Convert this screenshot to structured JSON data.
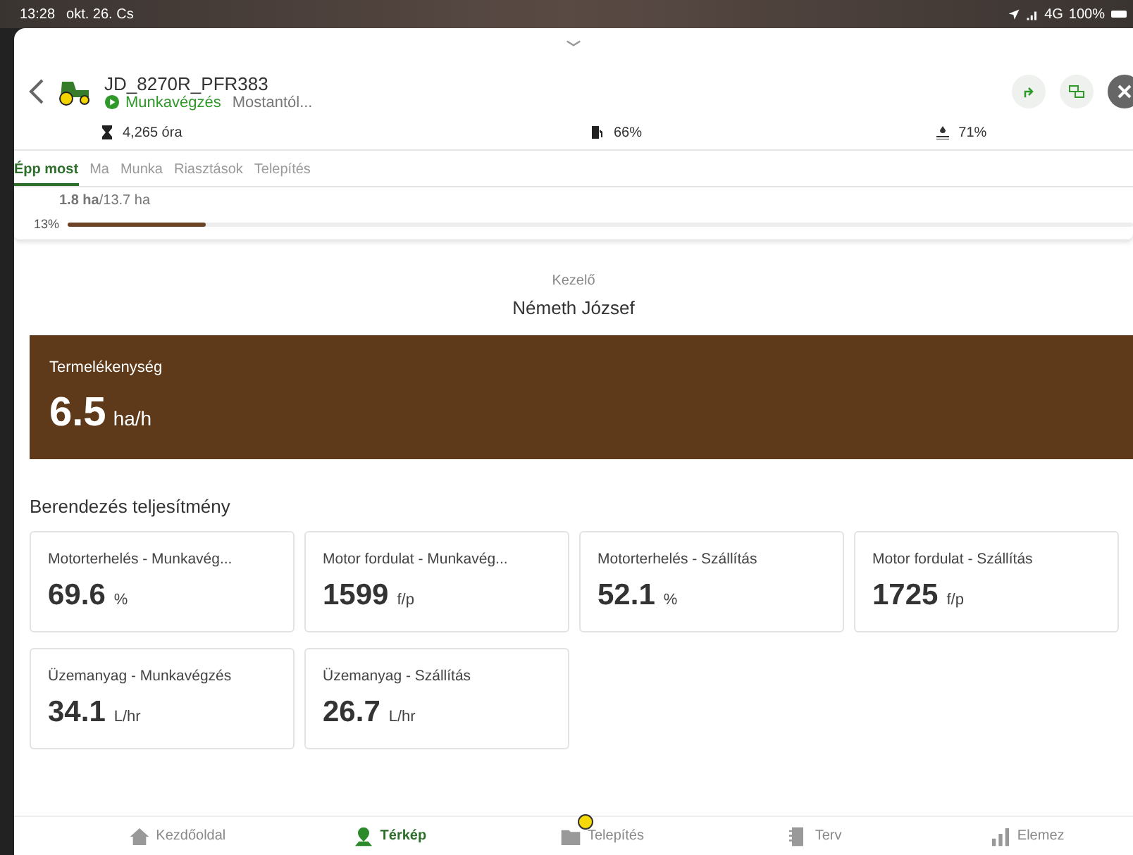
{
  "status_bar": {
    "time": "13:28",
    "date": "okt. 26. Cs",
    "network": "4G",
    "battery": "100%"
  },
  "header": {
    "title": "JD_8270R_PFR383",
    "state": "Munkavégzés",
    "since": "Mostantól..."
  },
  "stats": [
    {
      "kind": "hours",
      "text": "4,265 óra"
    },
    {
      "kind": "fuel",
      "text": "66%"
    },
    {
      "kind": "def",
      "text": "71%"
    }
  ],
  "tabs": [
    {
      "label": "Épp most",
      "selected": true
    },
    {
      "label": "Ma",
      "selected": false
    },
    {
      "label": "Munka",
      "selected": false
    },
    {
      "label": "Riasztások",
      "selected": false
    },
    {
      "label": "Telepítés",
      "selected": false
    }
  ],
  "progress": {
    "area": "**1.8 ha**/13.7 ha",
    "percent": "13%",
    "level": 0.13
  },
  "operator": {
    "label": "Kezelő",
    "name": "Németh József"
  },
  "productivity": {
    "label": "Termelékenység",
    "value": "6.5",
    "unit": "ha/h"
  },
  "section_title": "Berendezés teljesítmény",
  "metrics": [
    {
      "label": "Motorterhelés - Munkavég...",
      "value": "69.6",
      "unit": "%"
    },
    {
      "label": "Motor fordulat - Munkavég...",
      "value": "1599",
      "unit": "f/p"
    },
    {
      "label": "Motorterhelés - Szállítás",
      "value": "52.1",
      "unit": "%"
    },
    {
      "label": "Motor fordulat - Szállítás",
      "value": "1725",
      "unit": "f/p"
    },
    {
      "label": "Üzemanyag - Munkavégzés",
      "value": "34.1",
      "unit": "L/hr"
    },
    {
      "label": "Üzemanyag - Szállítás",
      "value": "26.7",
      "unit": "L/hr"
    }
  ],
  "nav": [
    {
      "kind": "home",
      "label": "Kezdőoldal",
      "selected": false,
      "badge": false
    },
    {
      "kind": "map",
      "label": "Térkép",
      "selected": true,
      "badge": false
    },
    {
      "kind": "setup",
      "label": "Telepítés",
      "selected": false,
      "badge": true
    },
    {
      "kind": "plan",
      "label": "Terv",
      "selected": false,
      "badge": false
    },
    {
      "kind": "analyze",
      "label": "Elemez",
      "selected": false,
      "badge": false
    }
  ]
}
